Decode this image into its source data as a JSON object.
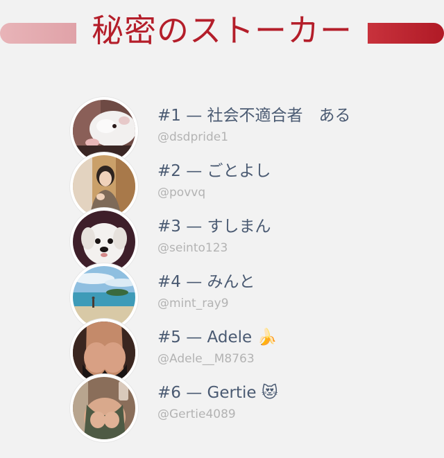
{
  "header": {
    "title": "秘密のストーカー"
  },
  "stalkers": [
    {
      "rank": "#1 — 社会不適合者　ある",
      "handle": "@dsdpride1"
    },
    {
      "rank": "#2 — ごとよし",
      "handle": "@povvq"
    },
    {
      "rank": "#3 — すしまん",
      "handle": "@seinto123"
    },
    {
      "rank": "#4 — みんと",
      "handle": "@mint_ray9"
    },
    {
      "rank": "#5 — Adele 🍌",
      "handle": "@Adele__M8763"
    },
    {
      "rank": "#6 — Gertie 😻",
      "handle": "@Gertie4089"
    }
  ]
}
